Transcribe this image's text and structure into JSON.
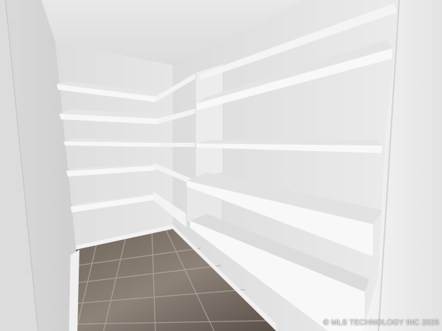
{
  "photo": {
    "subject": "empty walk-in pantry with white built-in shelving on two walls",
    "watermark": "© MLS TECHNOLOGY INC 2025"
  },
  "colors": {
    "wall": "#ececec",
    "ceiling": "#e2e2e2",
    "shelf_front": "#f7f7f7",
    "shelf_top": "#e6e6e6",
    "floor_tile": "#8d8379",
    "floor_grout": "#b3aa9f"
  }
}
